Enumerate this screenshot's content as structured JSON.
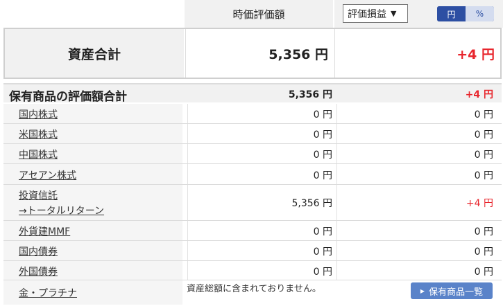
{
  "header": {
    "market_value_label": "時価評価額",
    "pl_dropdown_label": "評価損益",
    "pl_dropdown_arrow": "▼",
    "unit_toggle": {
      "yen": "円",
      "percent": "%"
    }
  },
  "total_assets": {
    "label": "資産合計",
    "value": "5,356 円",
    "pl": "+4 円"
  },
  "holdings_total": {
    "label": "保有商品の評価額合計",
    "value": "5,356 円",
    "pl": "+4 円"
  },
  "rows": [
    {
      "name": "国内株式",
      "value": "0 円",
      "pl": "0 円"
    },
    {
      "name": "米国株式",
      "value": "0 円",
      "pl": "0 円"
    },
    {
      "name": "中国株式",
      "value": "0 円",
      "pl": "0 円"
    },
    {
      "name": "アセアン株式",
      "value": "0 円",
      "pl": "0 円"
    },
    {
      "name": "投資信託",
      "sub": "→トータルリターン",
      "value": "5,356 円",
      "pl": "+4 円"
    },
    {
      "name": "外貨建MMF",
      "value": "0 円",
      "pl": "0 円"
    },
    {
      "name": "国内債券",
      "value": "0 円",
      "pl": "0 円"
    },
    {
      "name": "外国債券",
      "value": "0 円",
      "pl": "0 円"
    },
    {
      "name": "金・プラチナ"
    }
  ],
  "gold_note": "資産総額に含まれておりません。",
  "holdings_button": {
    "label": "保有商品一覧",
    "icon": "play-triangle-icon"
  },
  "colors": {
    "positive": "#e8262d",
    "accent": "#2d4fa3",
    "button": "#5a83c9"
  }
}
